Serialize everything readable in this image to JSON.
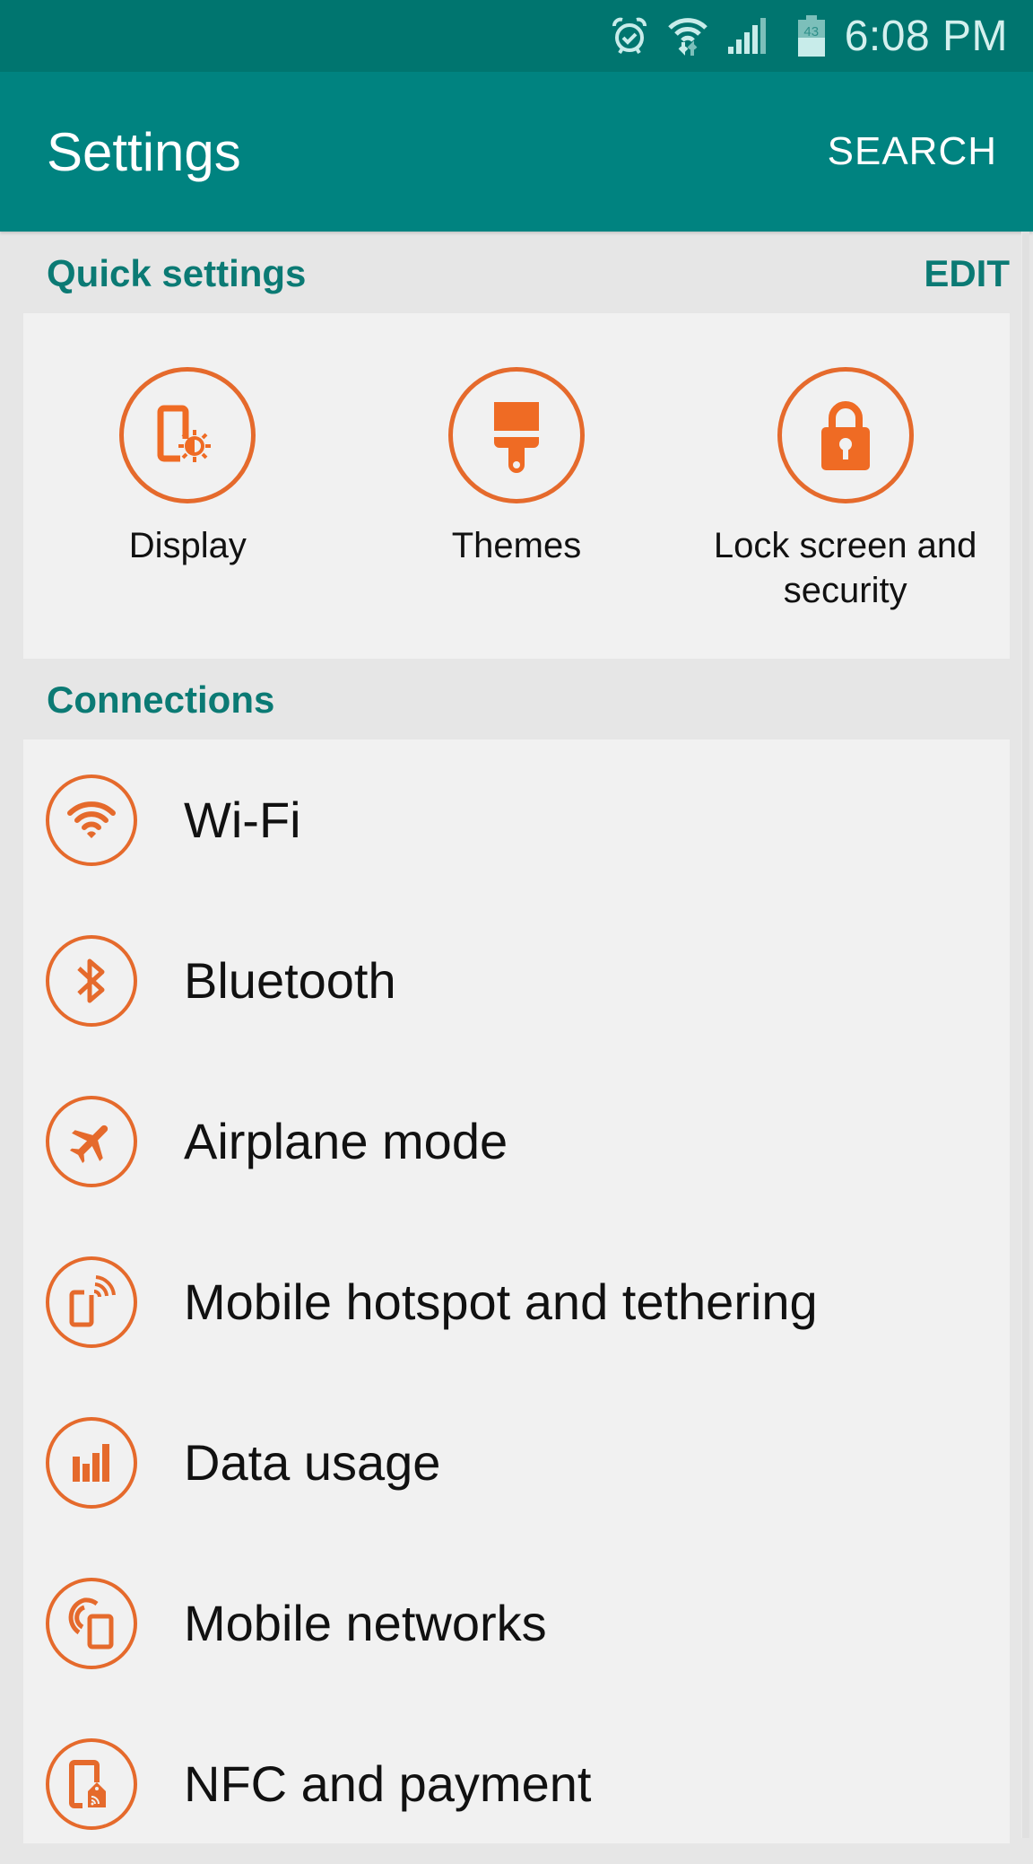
{
  "status_bar": {
    "icons": [
      "alarm-icon",
      "wifi-icon",
      "signal-icon",
      "battery-icon"
    ],
    "battery_level": "43",
    "time": "6:08 PM"
  },
  "app_bar": {
    "title": "Settings",
    "search_label": "SEARCH"
  },
  "quick_settings": {
    "title": "Quick settings",
    "edit_label": "EDIT",
    "items": [
      {
        "label": "Display",
        "icon": "display-icon"
      },
      {
        "label": "Themes",
        "icon": "paintbrush-icon"
      },
      {
        "label": "Lock screen and security",
        "icon": "lock-icon"
      }
    ]
  },
  "connections": {
    "title": "Connections",
    "items": [
      {
        "label": "Wi-Fi",
        "icon": "wifi-icon"
      },
      {
        "label": "Bluetooth",
        "icon": "bluetooth-icon"
      },
      {
        "label": "Airplane mode",
        "icon": "airplane-icon"
      },
      {
        "label": "Mobile hotspot and tethering",
        "icon": "hotspot-icon"
      },
      {
        "label": "Data usage",
        "icon": "data-usage-icon"
      },
      {
        "label": "Mobile networks",
        "icon": "mobile-networks-icon"
      },
      {
        "label": "NFC and payment",
        "icon": "nfc-icon"
      }
    ]
  },
  "colors": {
    "status_bar": "#00756f",
    "app_bar": "#008380",
    "accent_teal": "#0b7a74",
    "icon_orange": "#e56a2c",
    "background": "#e6e6e6",
    "card": "#f1f1f1"
  }
}
